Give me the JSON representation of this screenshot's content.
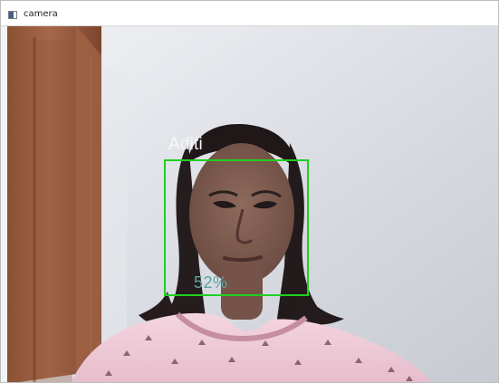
{
  "window": {
    "title": "camera"
  },
  "detection": {
    "name": "Aditi",
    "confidence": "52%",
    "box_color": "#1fd11f",
    "confidence_color": "#5ea3a0"
  },
  "icons": {
    "app": "camera-window-icon"
  }
}
